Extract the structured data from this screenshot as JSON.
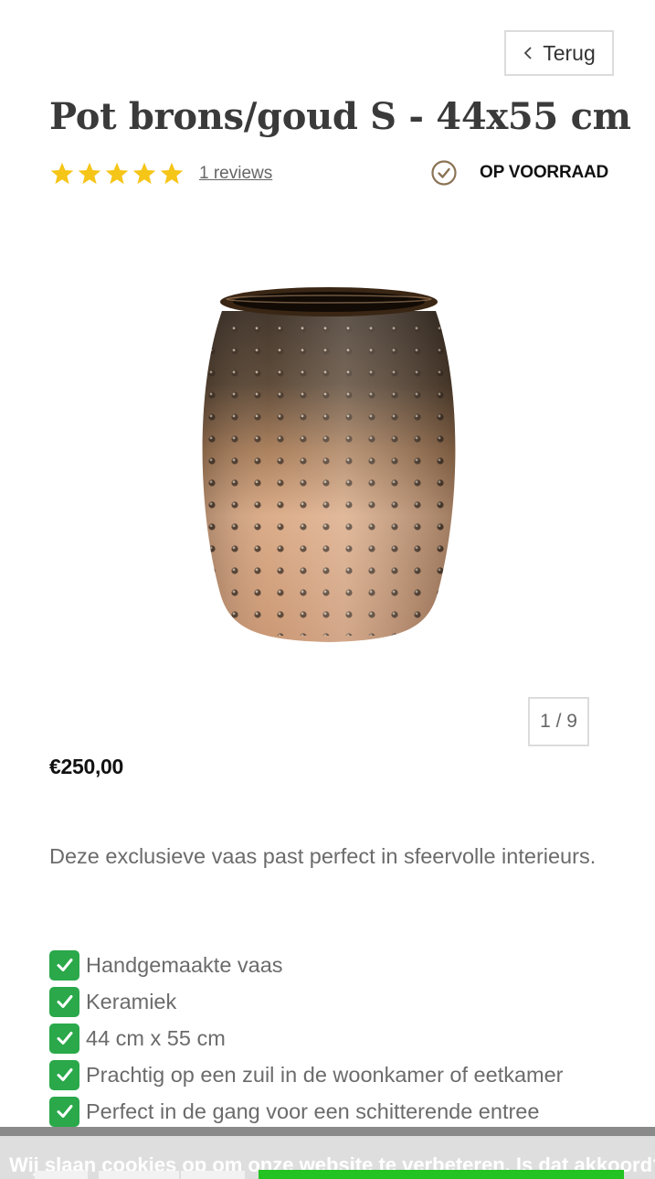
{
  "header": {
    "back_label": "Terug"
  },
  "product": {
    "title": "Pot brons/goud S - 44x55 cm",
    "rating": 5,
    "rating_max": 5,
    "reviews_label": "1 reviews",
    "stock_label": "OP VOORRAAD",
    "image_counter": "1 / 9",
    "price": "€250,00",
    "description": "Deze exclusieve vaas past perfect in sfeervolle interieurs.",
    "features": [
      "Handgemaakte vaas",
      "Keramiek",
      "44 cm x 55 cm",
      "Prachtig op een zuil in de woonkamer of eetkamer",
      "Perfect in de gang voor een schitterende entree"
    ]
  },
  "cookie": {
    "text_prefix": "Wij slaan ",
    "link_label": "cookies",
    "text_suffix": " op om onze website te verbeteren. Is dat akkoord?"
  },
  "colors": {
    "star": "#f5c518",
    "check_green": "#2aa84a",
    "accept_green": "#22c322",
    "stock_icon": "#8b7355"
  },
  "icons": {
    "back": "chevron-left-icon",
    "rating": "star-icon",
    "stock": "check-circle-icon",
    "feature": "check-box-icon"
  }
}
